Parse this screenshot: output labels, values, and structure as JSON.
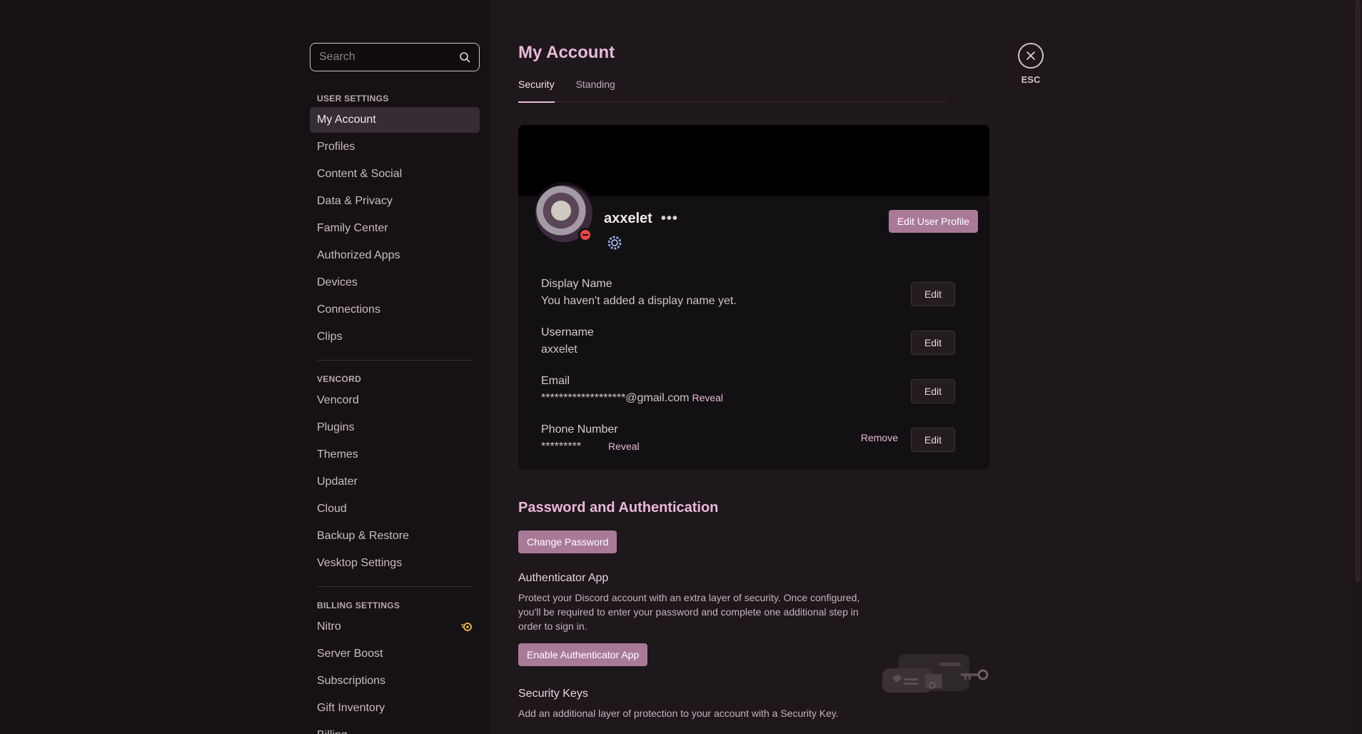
{
  "sidebar": {
    "search_placeholder": "Search",
    "sections": [
      {
        "header": "User Settings",
        "items": [
          "My Account",
          "Profiles",
          "Content & Social",
          "Data & Privacy",
          "Family Center",
          "Authorized Apps",
          "Devices",
          "Connections",
          "Clips"
        ]
      },
      {
        "header": "Vencord",
        "items": [
          "Vencord",
          "Plugins",
          "Themes",
          "Updater",
          "Cloud",
          "Backup & Restore",
          "Vesktop Settings"
        ]
      },
      {
        "header": "Billing Settings",
        "items": [
          "Nitro",
          "Server Boost",
          "Subscriptions",
          "Gift Inventory",
          "Billing"
        ]
      }
    ],
    "active_item": "My Account"
  },
  "main": {
    "title": "My Account",
    "tabs": [
      {
        "label": "Security",
        "active": true
      },
      {
        "label": "Standing",
        "active": false
      }
    ],
    "profile": {
      "username": "axxelet",
      "edit_profile_label": "Edit User Profile"
    },
    "fields": {
      "display_name": {
        "label": "Display Name",
        "value": "You haven't added a display name yet.",
        "edit": "Edit"
      },
      "username": {
        "label": "Username",
        "value": "axxelet",
        "edit": "Edit"
      },
      "email": {
        "label": "Email",
        "value": "*******************@gmail.com",
        "reveal": "Reveal",
        "edit": "Edit"
      },
      "phone": {
        "label": "Phone Number",
        "value": "*********",
        "reveal": "Reveal",
        "remove": "Remove",
        "edit": "Edit"
      }
    },
    "password_section": {
      "title": "Password and Authentication",
      "change_password": "Change Password",
      "authenticator_title": "Authenticator App",
      "authenticator_desc": "Protect your Discord account with an extra layer of security. Once configured, you'll be required to enter your password and complete one additional step in order to sign in.",
      "enable_authenticator": "Enable Authenticator App",
      "security_keys_title": "Security Keys",
      "security_keys_desc": "Add an additional layer of protection to your account with a Security Key."
    }
  },
  "close": {
    "label": "ESC"
  },
  "colors": {
    "accent": "#e8b9d8",
    "button": "#a97a98",
    "dnd": "#e8474b"
  }
}
